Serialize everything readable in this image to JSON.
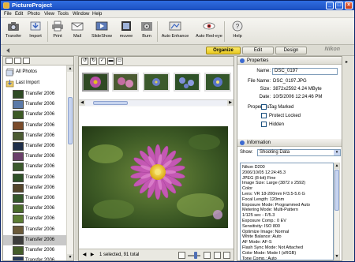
{
  "window": {
    "title": "PictureProject",
    "minimize": "_",
    "maximize": "□",
    "close": "×"
  },
  "menu": [
    "File",
    "Edit",
    "Photo",
    "View",
    "Tools",
    "Window",
    "Help"
  ],
  "toolbar": {
    "buttons": [
      "Transfer",
      "Import",
      "Print",
      "Mail",
      "SlideShow",
      "muvee",
      "Burn",
      "Auto Enhance",
      "Auto Red-eye",
      "Help"
    ]
  },
  "modes": {
    "tabs": [
      "Organize",
      "Edit",
      "Design"
    ],
    "active": "Organize",
    "brand": "Nikon"
  },
  "collections": {
    "all_photos": "All Photos",
    "last_import": "Last Import",
    "transfers": [
      "Transfer 2006",
      "Transfer 2006",
      "Transfer 2006",
      "Transfer 2006",
      "Transfer 2006",
      "Transfer 2006",
      "Transfer 2006",
      "Transfer 2006",
      "Transfer 2006",
      "Transfer 2006",
      "Transfer 2006",
      "Transfer 2006",
      "Transfer 2006",
      "Transfer 2006",
      "Transfer 2006",
      "Transfer 2006",
      "Transfer 2006"
    ],
    "selected_index": 14
  },
  "browser": {
    "status": "1 selected, 91 total"
  },
  "properties": {
    "header": "Properties",
    "name_label": "Name:",
    "name_value": "DSC_0197",
    "filename_label": "File Name:",
    "filename_value": "DSC_0197.JPG",
    "size_label": "Size:",
    "size_value": "3872x2592  4.24 MByte",
    "date_label": "Date:",
    "date_value": "10/5/2006 12:24:46 PM",
    "properties_label": "Properties:",
    "checkboxes": [
      "Tag Marked",
      "Protect Locked",
      "Hidden"
    ]
  },
  "information": {
    "header": "Information",
    "show_label": "Show:",
    "show_value": "Shooting Data",
    "dropdown_arrow": "▾",
    "lines": [
      "Nikon D200",
      "2006/10/05 12:24:45.3",
      "JPEG (8-bit) Fine",
      "Image Size: Large (3872 x 2592)",
      "Color",
      "Lens: VR 18-200mm F/3.5-5.6 G",
      "Focal Length: 120mm",
      "Exposure Mode: Programmed Auto",
      "Metering Mode: Multi-Pattern",
      "1/125 sec - F/5.3",
      "Exposure Comp.: 0 EV",
      "Sensitivity: ISO 800",
      "Optimize Image: Normal",
      "White Balance: Auto",
      "AF Mode: AF-S",
      "Flash Sync Mode: Not Attached",
      "Color Mode: Mode I (sRGB)",
      "Tone Comp.: Auto"
    ]
  },
  "colors": {
    "titlebar": "#2f6ce0",
    "active_tab": "#f0d43a",
    "panel_bg": "#e9e8e1"
  }
}
